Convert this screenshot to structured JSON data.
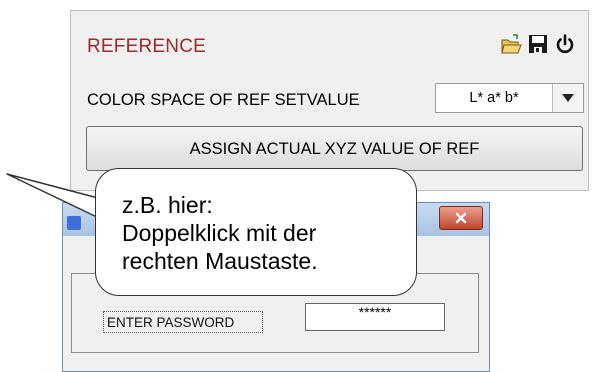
{
  "reference": {
    "title": "REFERENCE",
    "title_color": "#9b2a2a",
    "toolbar_icons": [
      "open-folder-icon",
      "save-icon",
      "power-icon"
    ],
    "color_space_label": "COLOR SPACE OF REF SETVALUE",
    "color_space_value": "L* a* b*",
    "assign_button": "ASSIGN ACTUAL XYZ VALUE OF REF"
  },
  "dialog": {
    "close_icon": "close-icon",
    "password_label": "ENTER PASSWORD",
    "password_value": "******",
    "close_color": "#c3452d"
  },
  "callout": {
    "lines": [
      "z.B. hier:",
      "Doppelklick mit der",
      "rechten Maustaste."
    ]
  }
}
